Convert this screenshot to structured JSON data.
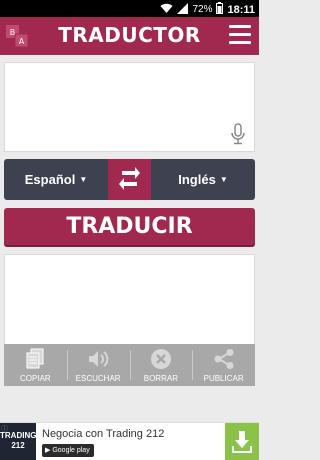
{
  "status_bar": {
    "battery_pct": "72%",
    "time": "18:11",
    "icons": [
      "wifi-icon",
      "signal-icon",
      "battery-icon"
    ]
  },
  "app_bar": {
    "title": "TRADUCTOR",
    "logo": "translator-logo-icon",
    "menu": "hamburger-menu-icon"
  },
  "input": {
    "value": "",
    "mic_icon": "microphone-icon"
  },
  "languages": {
    "source": "Español",
    "target": "Inglés",
    "swap_icon": "swap-arrows-icon"
  },
  "translate_button": {
    "label": "TRADUCIR"
  },
  "output": {
    "value": ""
  },
  "actions": [
    {
      "label": "COPIAR",
      "icon": "copy-icon"
    },
    {
      "label": "ESCUCHAR",
      "icon": "speaker-icon"
    },
    {
      "label": "BORRAR",
      "icon": "clear-icon"
    },
    {
      "label": "PUBLICAR",
      "icon": "share-icon"
    }
  ],
  "ad": {
    "logo_line1": "TRADING",
    "logo_line2": "212",
    "text": "Negocia con Trading 212",
    "badge": "Google play",
    "download_icon": "download-icon"
  },
  "colors": {
    "accent": "#a1284e",
    "lang_bar": "#3d4150",
    "action_bar": "#a8a8a8",
    "ad_download": "#8bc34a"
  }
}
